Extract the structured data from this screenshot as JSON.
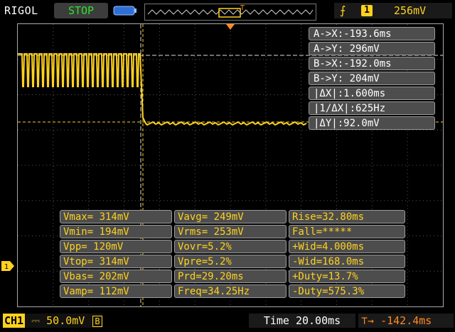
{
  "header": {
    "brand": "RIGOL",
    "run_status": "STOP",
    "trigger_channel": "1",
    "trigger_level": "256mV"
  },
  "cursors": [
    "A->X:-193.6ms",
    "A->Y: 296mV",
    "B->X:-192.0ms",
    "B->Y: 204mV",
    "|ΔX|:1.600ms",
    "|1/ΔX|:625Hz",
    "|ΔY|:92.0mV"
  ],
  "measurements": [
    [
      "Vmax= 314mV",
      "Vavg= 249mV",
      "Rise=32.80ms"
    ],
    [
      "Vmin= 194mV",
      "Vrms= 253mV",
      "Fall=*****"
    ],
    [
      "Vpp= 120mV",
      "Vovr=5.2%",
      "+Wid=4.000ms"
    ],
    [
      "Vtop= 314mV",
      "Vpre=5.2%",
      "-Wid=168.0ms"
    ],
    [
      "Vbas= 202mV",
      "Prd=29.20ms",
      "+Duty=13.7%"
    ],
    [
      "Vamp= 112mV",
      "Freq=34.25Hz",
      "-Duty=575.3%"
    ]
  ],
  "footer": {
    "channel_label": "CH1",
    "volts_per_div": "50.0mV",
    "bandwidth_tag": "B",
    "timebase": "Time 20.00ms",
    "trigger_offset": "-142.4ms"
  },
  "channel_marker": "1",
  "colors": {
    "trace": "#ffd21f",
    "stop": "#2fe02f",
    "offset": "#ff8a1f",
    "panel": "#4d4d4d"
  }
}
